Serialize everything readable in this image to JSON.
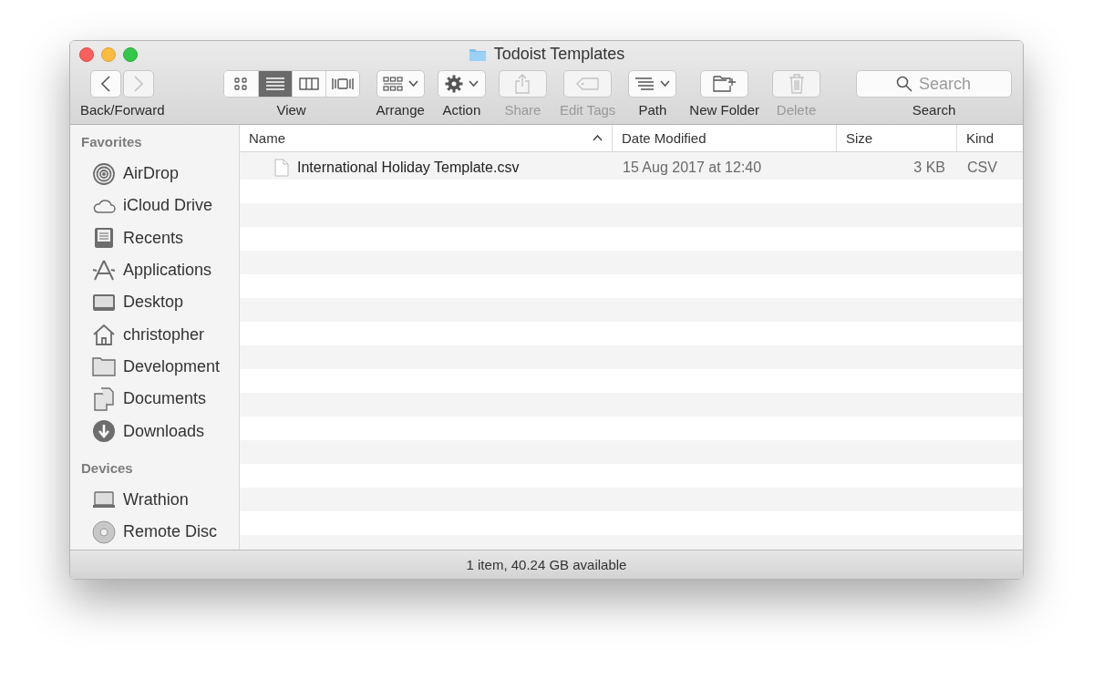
{
  "window": {
    "title": "Todoist Templates"
  },
  "toolbar": [
    {
      "kind": "nav",
      "label": "Back/Forward",
      "buttons": [
        {
          "disabled": false
        },
        {
          "disabled": true
        }
      ]
    },
    {
      "kind": "segmented",
      "label": "View",
      "segments": [
        {
          "selected": false
        },
        {
          "selected": true
        },
        {
          "selected": false
        },
        {
          "selected": false
        }
      ]
    },
    {
      "kind": "dropdown",
      "label": "Arrange",
      "disabled": false
    },
    {
      "kind": "dropdown",
      "label": "Action",
      "disabled": false
    },
    {
      "kind": "button",
      "label": "Share",
      "disabled": true
    },
    {
      "kind": "button",
      "label": "Edit Tags",
      "disabled": true
    },
    {
      "kind": "dropdown",
      "label": "Path",
      "disabled": false
    },
    {
      "kind": "button",
      "label": "New Folder",
      "disabled": false
    },
    {
      "kind": "button",
      "label": "Delete",
      "disabled": true
    },
    {
      "kind": "search",
      "label": "Search",
      "placeholder": "Search"
    }
  ],
  "sidebar": {
    "sections": [
      {
        "title": "Favorites",
        "items": [
          {
            "label": "AirDrop"
          },
          {
            "label": "iCloud Drive"
          },
          {
            "label": "Recents"
          },
          {
            "label": "Applications"
          },
          {
            "label": "Desktop"
          },
          {
            "label": "christopher"
          },
          {
            "label": "Development"
          },
          {
            "label": "Documents"
          },
          {
            "label": "Downloads"
          }
        ]
      },
      {
        "title": "Devices",
        "items": [
          {
            "label": "Wrathion"
          },
          {
            "label": "Remote Disc"
          }
        ]
      }
    ]
  },
  "table": {
    "columns": [
      {
        "label": "Name",
        "sorted": true
      },
      {
        "label": "Date Modified",
        "sorted": false
      },
      {
        "label": "Size",
        "sorted": false
      },
      {
        "label": "Kind",
        "sorted": false
      }
    ],
    "rows": [
      {
        "cells": [
          "International Holiday Template.csv",
          "15 Aug 2017 at 12:40",
          "3 KB",
          "CSV"
        ]
      }
    ]
  },
  "status_bar": "1 item, 40.24 GB available"
}
